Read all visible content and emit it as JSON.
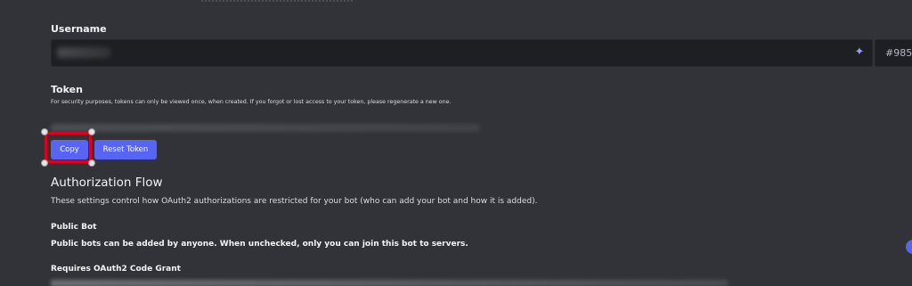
{
  "username": {
    "label": "Username",
    "value": "●●●●●●●●",
    "discriminator": "#985"
  },
  "token": {
    "label": "Token",
    "description": "For security purposes, tokens can only be viewed once, when created. If you forgot or lost access to your token, please regenerate a new one.",
    "value": "●●●●●●●●●●●●●●●●●●●●●●●●●●●●●●",
    "copy_label": "Copy",
    "reset_label": "Reset Token"
  },
  "authorization": {
    "title": "Authorization Flow",
    "description": "These settings control how OAuth2 authorizations are restricted for your bot (who can add your bot and how it is added).",
    "public_bot": {
      "title": "Public Bot",
      "description": "Public bots can be added by anyone. When unchecked, only you can join this bot to servers.",
      "enabled": true
    },
    "code_grant": {
      "title": "Requires OAuth2 Code Grant"
    }
  },
  "icons": {
    "sparkle": "sparkle-icon"
  },
  "colors": {
    "background": "#313338",
    "input_background": "#1e1f22",
    "brand": "#5865f2",
    "highlight": "#e0001b"
  }
}
